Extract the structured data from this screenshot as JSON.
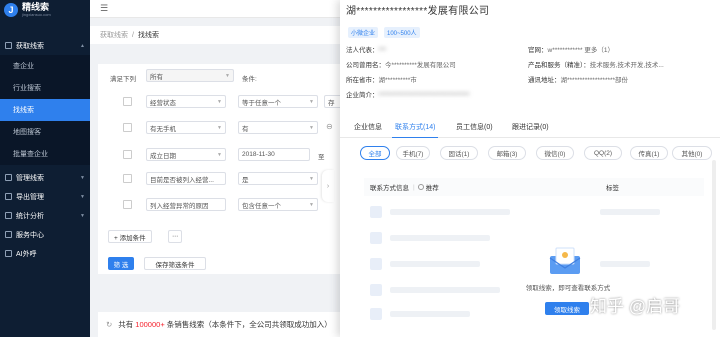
{
  "app": {
    "name": "精线索",
    "subtitle": "jingxiansuo.com"
  },
  "sidebar": {
    "groups": [
      {
        "label": "获取线索",
        "expanded": true
      },
      {
        "label": "管理线索"
      },
      {
        "label": "导出管理"
      },
      {
        "label": "统计分析"
      },
      {
        "label": "服务中心"
      },
      {
        "label": "AI外呼"
      }
    ],
    "subitems": [
      "查企业",
      "行业搜索",
      "找线索",
      "地图搜客",
      "批量查企业"
    ],
    "active_sub": "找线索"
  },
  "breadcrumb": {
    "root": "获取线索",
    "sep": "/",
    "current": "找线索"
  },
  "filter": {
    "match_prefix": "满足下列",
    "match_value": "所有",
    "condition_label": "条件:",
    "rows": [
      {
        "field": "经营状态",
        "op": "等于任意一个",
        "value": "存"
      },
      {
        "field": "有无手机",
        "op": "有",
        "value": ""
      },
      {
        "field": "成立日期",
        "op": "2018-11-30",
        "value": "至"
      },
      {
        "field": "目前是否被列入经营...",
        "op": "是",
        "value": ""
      },
      {
        "field": "列入经营异常的原因",
        "op": "包含任意一个",
        "value": ""
      }
    ],
    "add_condition": "+ 添加条件",
    "more": "⋯",
    "search_button": "筛 选",
    "save_button": "保存筛选条件"
  },
  "summary": {
    "prefix": "共有",
    "count": "100000+",
    "rest": "条销售线索（本条件下，全公司共领取成功加入）"
  },
  "drawer": {
    "title": "湖*****************发展有限公司",
    "tags": [
      "小微企业",
      "100~500人"
    ],
    "info": [
      {
        "k": "法人代表：",
        "v": "*** "
      },
      {
        "k": "官网：",
        "v": "w************ 更多（1）"
      },
      {
        "k": "公司曾用名：",
        "v": "今**********发展有限公司"
      },
      {
        "k": "产品和服务（精准）：",
        "v": "技术服务,技术开发,技术..."
      },
      {
        "k": "所在省市：",
        "v": "湖**********市"
      },
      {
        "k": "通讯地址：",
        "v": "湖*******************部份"
      },
      {
        "k": "企业简介：",
        "v": "************************************"
      }
    ],
    "tabs": [
      "企业信息",
      "联系方式(14)",
      "员工信息(0)",
      "跟进记录(0)"
    ],
    "active_tab": "联系方式(14)",
    "pills": [
      "全部",
      "手机(7)",
      "固话(1)",
      "邮箱(3)",
      "微信(0)",
      "QQ(2)",
      "传真(1)",
      "其他(0)"
    ],
    "active_pill": "全部",
    "table": {
      "col1": "联系方式信息",
      "recommend": "推荐",
      "col2": "标签"
    },
    "empty_text": "领取线索，即可查看联系方式",
    "get_button": "领取线索"
  },
  "watermark": "知乎 @启哥"
}
